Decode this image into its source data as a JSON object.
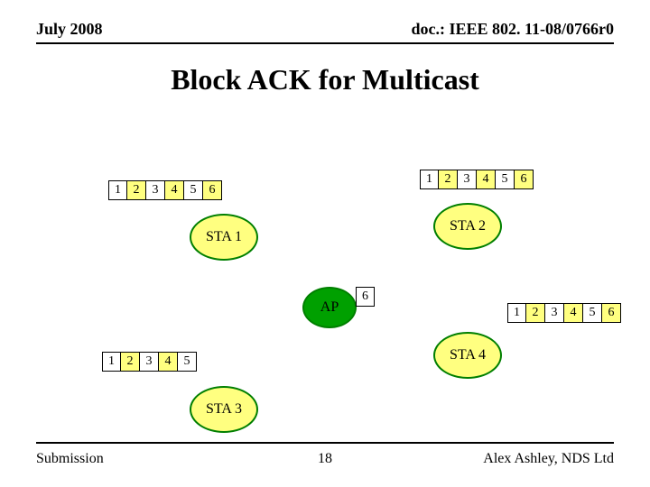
{
  "header": {
    "left": "July 2008",
    "right": "doc.: IEEE 802. 11-08/0766r0"
  },
  "title": "Block ACK for Multicast",
  "nodes": {
    "sta1": "STA 1",
    "sta2": "STA 2",
    "sta3": "STA 3",
    "sta4": "STA 4",
    "ap": "AP"
  },
  "packets": {
    "pattern6": [
      "w",
      "b",
      "w",
      "b",
      "w",
      "b"
    ],
    "pattern5": [
      "w",
      "b",
      "w",
      "b",
      "w"
    ],
    "ap": [
      "w"
    ],
    "sta1": [
      "1",
      "2",
      "3",
      "4",
      "5",
      "6"
    ],
    "sta2": [
      "1",
      "2",
      "3",
      "4",
      "5",
      "6"
    ],
    "sta3": [
      "1",
      "2",
      "3",
      "4",
      "5"
    ],
    "sta4": [
      "1",
      "2",
      "3",
      "4",
      "5",
      "6"
    ],
    "ap_n": [
      "6"
    ]
  },
  "footer": {
    "left": "Submission",
    "page": "18",
    "right": "Alex Ashley, NDS Ltd"
  }
}
